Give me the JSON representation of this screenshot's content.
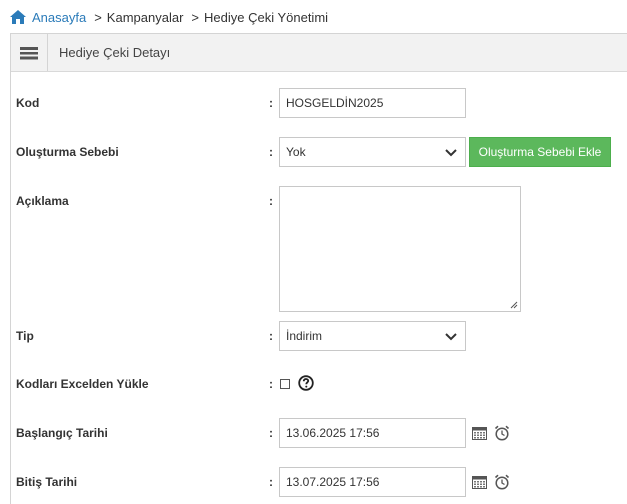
{
  "breadcrumb": {
    "home": "Anasayfa",
    "separator": ">",
    "items": [
      "Kampanyalar",
      "Hediye Çeki Yönetimi"
    ]
  },
  "panel": {
    "title": "Hediye Çeki Detayı"
  },
  "form": {
    "colon": ":",
    "kod": {
      "label": "Kod",
      "value": "HOSGELDİN2025"
    },
    "sebep": {
      "label": "Oluşturma Sebebi",
      "value": "Yok",
      "button": "Oluşturma Sebebi Ekle"
    },
    "aciklama": {
      "label": "Açıklama",
      "value": ""
    },
    "tip": {
      "label": "Tip",
      "value": "İndirim"
    },
    "excel": {
      "label": "Kodları Excelden Yükle",
      "checked": false
    },
    "baslangic": {
      "label": "Başlangıç Tarihi",
      "value": "13.06.2025 17:56"
    },
    "bitis": {
      "label": "Bitiş Tarihi",
      "value": "13.07.2025 17:56"
    }
  },
  "icons": {
    "home": "home-icon",
    "menu": "hamburger-menu-icon",
    "chevron": "chevron-down-icon",
    "help": "question-circle-icon",
    "calendar": "calendar-icon",
    "alarm": "alarm-clock-icon"
  },
  "colors": {
    "link": "#2b7bb9",
    "button_green": "#5cb85c",
    "header_bg": "#f2f2f2"
  }
}
